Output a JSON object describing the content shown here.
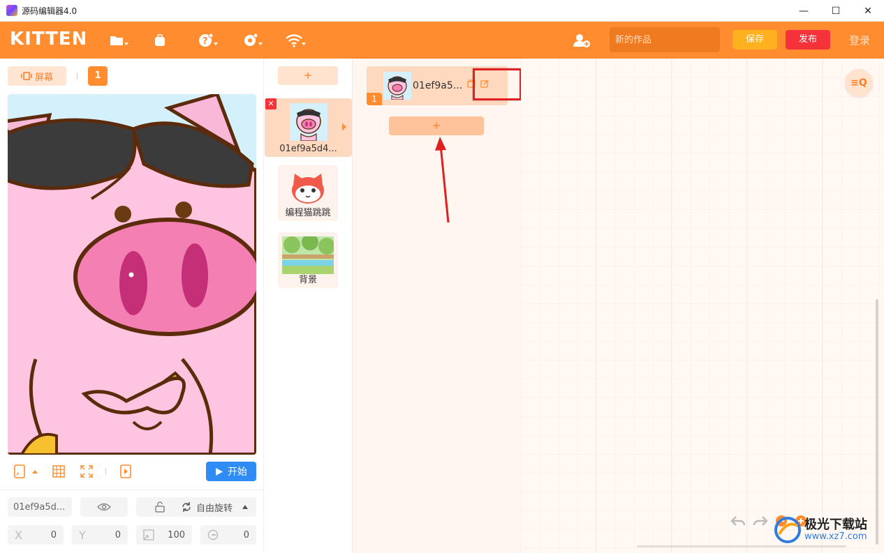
{
  "window": {
    "title": "源码编辑器4.0",
    "controls": [
      "—",
      "☐",
      "✕"
    ]
  },
  "topbar": {
    "logo": "KITTEN",
    "work_title_placeholder": "新的作品",
    "save_label": "保存",
    "publish_label": "发布",
    "login_label": "登录",
    "accent": "#ff8c2e"
  },
  "stage": {
    "screen_label": "屏幕",
    "page_number": "1",
    "start_label": "开始"
  },
  "props": {
    "sprite_name": "01ef9a5d...",
    "rotation_label": "自由旋转",
    "x_label": "X",
    "x_value": "0",
    "y_label": "Y",
    "y_value": "0",
    "size_value": "100",
    "direction_value": "0"
  },
  "sprites": {
    "add_label": "+",
    "items": [
      {
        "label": "01ef9a5d4..."
      },
      {
        "label": "编程猫跳跳"
      },
      {
        "label": "背景"
      }
    ]
  },
  "costumes": {
    "items": [
      {
        "number": "1",
        "name": "01ef9a5..."
      }
    ],
    "add_label": "+"
  },
  "canvas": {
    "search_label": "≡Q"
  },
  "watermark": {
    "title": "极光下载站",
    "sub": "www.xz7.com"
  }
}
